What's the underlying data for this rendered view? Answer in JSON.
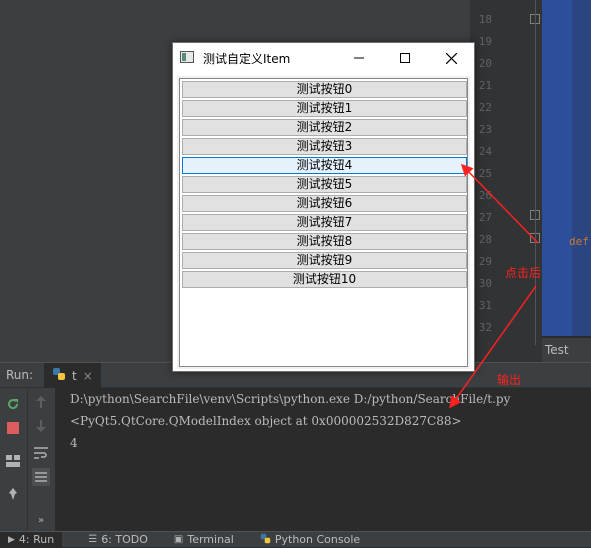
{
  "editor": {
    "line_numbers": [
      "18",
      "19",
      "20",
      "21",
      "22",
      "23",
      "24",
      "25",
      "26",
      "27",
      "28",
      "29",
      "30",
      "31",
      "32"
    ],
    "code_snippet": "def",
    "test_tab": "Test"
  },
  "run_panel": {
    "label": "Run:",
    "tab_name": "t",
    "tab_close": "×",
    "console_lines": [
      "D:\\python\\SearchFile\\venv\\Scripts\\python.exe D:/python/SearchFile/t.py",
      "<PyQt5.QtCore.QModelIndex object at 0x000002532D827C88>",
      "4"
    ]
  },
  "bottom_bar": {
    "tabs": [
      {
        "icon": "play-icon",
        "label": "4: Run",
        "active": true
      },
      {
        "icon": "list-icon",
        "label": "6: TODO",
        "active": false
      },
      {
        "icon": "terminal-icon",
        "label": "Terminal",
        "active": false
      },
      {
        "icon": "python-console-icon",
        "label": "Python Console",
        "active": false
      }
    ]
  },
  "qt_window": {
    "title": "测试自定义Item",
    "minimize": "—",
    "items": [
      {
        "label": "测试按钮0",
        "selected": false
      },
      {
        "label": "测试按钮1",
        "selected": false
      },
      {
        "label": "测试按钮2",
        "selected": false
      },
      {
        "label": "测试按钮3",
        "selected": false
      },
      {
        "label": "测试按钮4",
        "selected": true
      },
      {
        "label": "测试按钮5",
        "selected": false
      },
      {
        "label": "测试按钮6",
        "selected": false
      },
      {
        "label": "测试按钮7",
        "selected": false
      },
      {
        "label": "测试按钮8",
        "selected": false
      },
      {
        "label": "测试按钮9",
        "selected": false
      },
      {
        "label": "测试按钮10",
        "selected": false
      }
    ]
  },
  "annotations": {
    "click_label": "点击后",
    "output_label": "输出",
    "color": "#ff2020"
  },
  "colors": {
    "ide_background": "#2b2b2b",
    "selection_border": "#0078d7",
    "selection_fill": "#e5f1fb"
  }
}
